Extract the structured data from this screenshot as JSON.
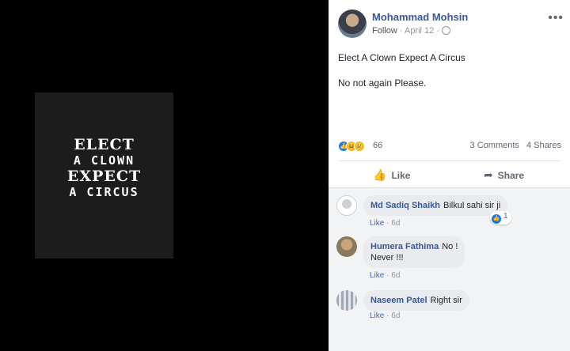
{
  "poster": {
    "lines": [
      "ELECT",
      "A CLOWN",
      "EXPECT",
      "A CIRCUS"
    ]
  },
  "post": {
    "author": "Mohammad Mohsin",
    "follow_label": "Follow",
    "separator": "·",
    "date": "April 12",
    "more_label": "•••",
    "paragraphs": [
      "Elect A Clown Expect A Circus",
      "No not again Please."
    ],
    "reaction_count": "66",
    "comments_count": "3 Comments",
    "shares_count": "4 Shares",
    "like_label": "Like",
    "share_label": "Share"
  },
  "comments": [
    {
      "name": "Md Sadiq Shaikh",
      "text": "Bilkul sahi sir ji",
      "like_label": "Like",
      "time": "6d",
      "reactions": "1"
    },
    {
      "name": "Humera Fathima",
      "text_line1": "No !",
      "text_line2": "Never !!!",
      "like_label": "Like",
      "time": "6d"
    },
    {
      "name": "Naseem Patel",
      "text": "Right sir",
      "like_label": "Like",
      "time": "6d"
    }
  ],
  "colors": {
    "link": "#385898",
    "like_blue": "#1877f2",
    "muted": "#90949c",
    "comment_bg": "#f2f3f5"
  },
  "icons": [
    "globe-icon",
    "more-icon",
    "like-reaction-icon",
    "haha-reaction-icon",
    "sad-reaction-icon",
    "thumbs-up-icon",
    "share-arrow-icon"
  ]
}
